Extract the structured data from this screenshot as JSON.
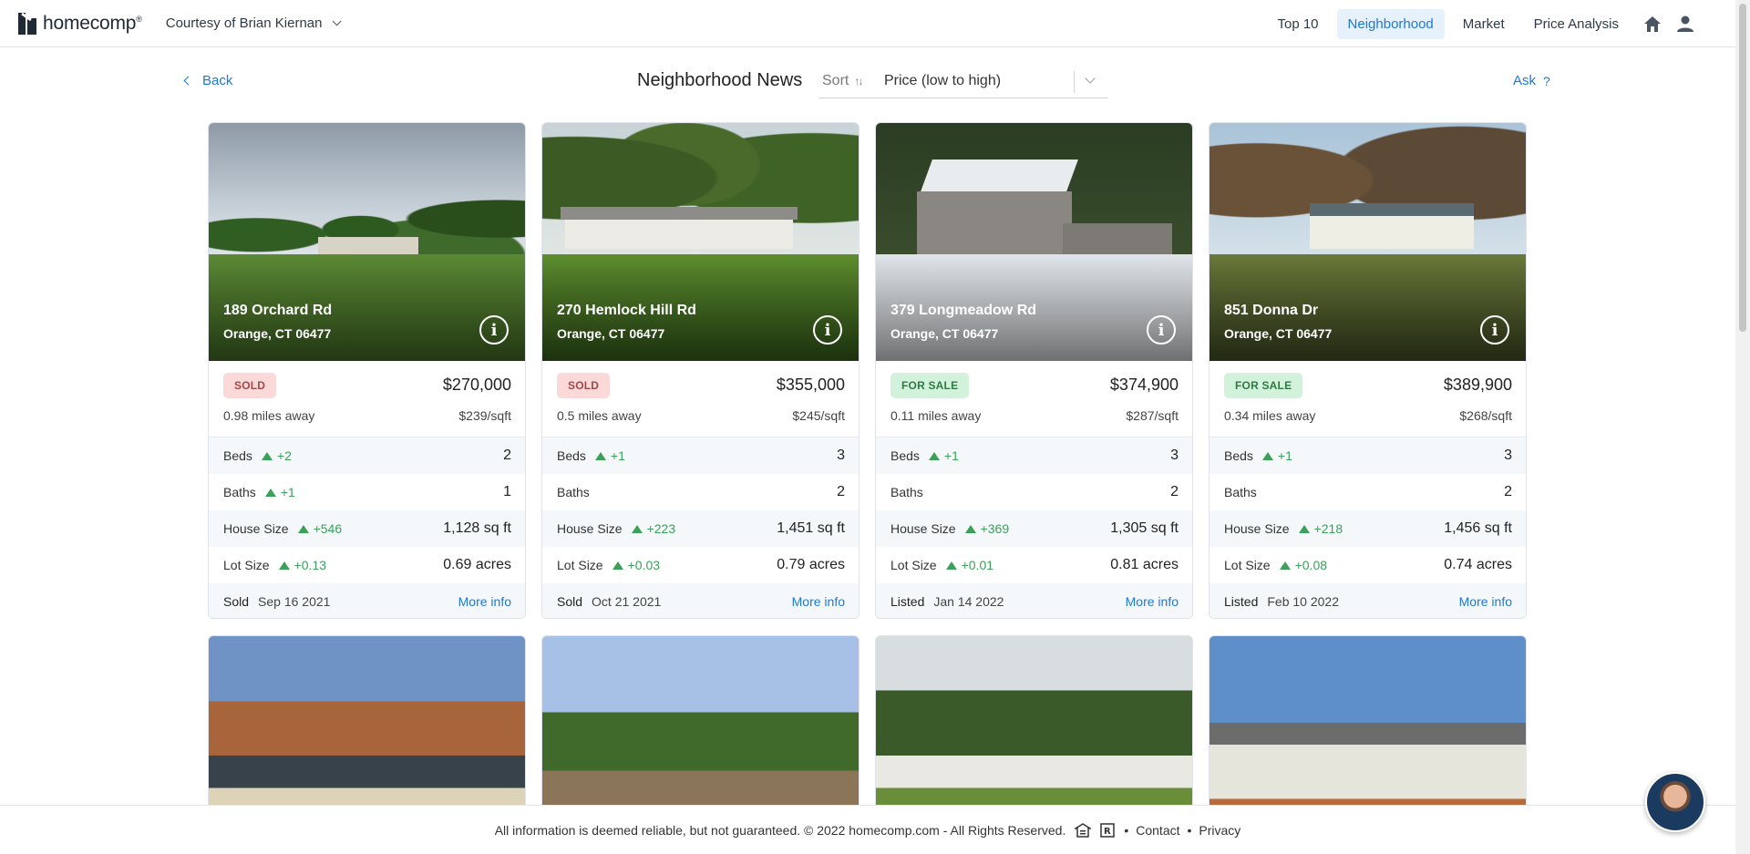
{
  "brand": {
    "name": "homecomp"
  },
  "header": {
    "courtesy": "Courtesy of Brian Kiernan",
    "nav": [
      "Top 10",
      "Neighborhood",
      "Market",
      "Price Analysis"
    ]
  },
  "subheader": {
    "back": "Back",
    "title": "Neighborhood News",
    "sort_label": "Sort",
    "sort_value": "Price (low to high)",
    "ask": "Ask"
  },
  "labels": {
    "beds": "Beds",
    "baths": "Baths",
    "house_size": "House Size",
    "lot_size": "Lot Size",
    "more_info": "More info"
  },
  "cards": [
    {
      "address": "189 Orchard Rd",
      "city": "Orange, CT 06477",
      "status": "SOLD",
      "price": "$270,000",
      "distance": "0.98 miles away",
      "ppsf": "$239/sqft",
      "beds": "2",
      "beds_delta": "+2",
      "baths": "1",
      "baths_delta": "+1",
      "size": "1,128 sq ft",
      "size_delta": "+546",
      "lot": "0.69 acres",
      "lot_delta": "+0.13",
      "date_label": "Sold",
      "date": "Sep 16 2021"
    },
    {
      "address": "270 Hemlock Hill Rd",
      "city": "Orange, CT 06477",
      "status": "SOLD",
      "price": "$355,000",
      "distance": "0.5 miles away",
      "ppsf": "$245/sqft",
      "beds": "3",
      "beds_delta": "+1",
      "baths": "2",
      "baths_delta": "",
      "size": "1,451 sq ft",
      "size_delta": "+223",
      "lot": "0.79 acres",
      "lot_delta": "+0.03",
      "date_label": "Sold",
      "date": "Oct 21 2021"
    },
    {
      "address": "379 Longmeadow Rd",
      "city": "Orange, CT 06477",
      "status": "FOR SALE",
      "price": "$374,900",
      "distance": "0.11 miles away",
      "ppsf": "$287/sqft",
      "beds": "3",
      "beds_delta": "+1",
      "baths": "2",
      "baths_delta": "",
      "size": "1,305 sq ft",
      "size_delta": "+369",
      "lot": "0.81 acres",
      "lot_delta": "+0.01",
      "date_label": "Listed",
      "date": "Jan 14 2022"
    },
    {
      "address": "851 Donna Dr",
      "city": "Orange, CT 06477",
      "status": "FOR SALE",
      "price": "$389,900",
      "distance": "0.34 miles away",
      "ppsf": "$268/sqft",
      "beds": "3",
      "beds_delta": "+1",
      "baths": "2",
      "baths_delta": "",
      "size": "1,456 sq ft",
      "size_delta": "+218",
      "lot": "0.74 acres",
      "lot_delta": "+0.08",
      "date_label": "Listed",
      "date": "Feb 10 2022"
    }
  ],
  "footer": {
    "text": "All information is deemed reliable, but not guaranteed. © 2022 homecomp.com - All Rights Reserved.",
    "contact": "Contact",
    "privacy": "Privacy"
  },
  "colors": {
    "accent": "#1e78d6",
    "sold_bg": "#fbd9d9",
    "forsale_bg": "#d3f2db",
    "delta_green": "#3aa05a"
  }
}
